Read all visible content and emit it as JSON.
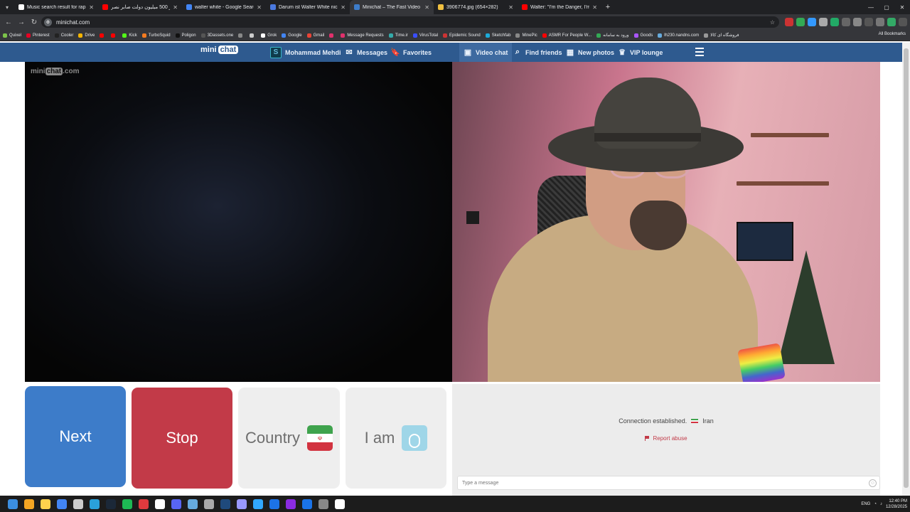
{
  "browser": {
    "tabs": [
      {
        "title": "Music search result for rap | Ep",
        "color": "#ffffff",
        "icon": "pixabay-icon"
      },
      {
        "title": "از 500 میلیون دولت صابر نصر... ",
        "color": "#ff0000",
        "icon": "youtube-icon"
      },
      {
        "title": "walter white - Google Search",
        "color": "#4285f4",
        "icon": "google-icon"
      },
      {
        "title": "Darum ist Walter White nicht b",
        "color": "#4a79e0",
        "icon": "site-icon"
      },
      {
        "title": "Minichat – The Fast Video C",
        "color": "#3d7cc9",
        "icon": "minichat-icon",
        "active": true
      },
      {
        "title": "3906774.jpg (654×282)",
        "color": "#f0c040",
        "icon": "image-icon"
      },
      {
        "title": "Walter: \"I'm the Danger, I'm the",
        "color": "#ff0000",
        "icon": "youtube-icon"
      }
    ],
    "url": "minichat.com",
    "bookmarks": [
      {
        "label": "Quixel",
        "color": "#7cc34a"
      },
      {
        "label": "Pinterest",
        "color": "#e60023"
      },
      {
        "label": "Cooler",
        "color": "#222"
      },
      {
        "label": "Drive",
        "color": "#f4b400"
      },
      {
        "label": "",
        "color": "#ff0000"
      },
      {
        "label": "",
        "color": "#ff0000"
      },
      {
        "label": "Kick",
        "color": "#53fc18"
      },
      {
        "label": "TurboSquid",
        "color": "#f47b20"
      },
      {
        "label": "Poligon",
        "color": "#111"
      },
      {
        "label": "3Dassets.one",
        "color": "#555"
      },
      {
        "label": "",
        "color": "#888"
      },
      {
        "label": "",
        "color": "#ccc"
      },
      {
        "label": "Grok",
        "color": "#fff"
      },
      {
        "label": "Google",
        "color": "#4285f4"
      },
      {
        "label": "Gmail",
        "color": "#ea4335"
      },
      {
        "label": "",
        "color": "#e1306c"
      },
      {
        "label": "Message Requests",
        "color": "#e1306c"
      },
      {
        "label": "Time.ir",
        "color": "#3aa"
      },
      {
        "label": "VirusTotal",
        "color": "#394eff"
      },
      {
        "label": "Epidemic Sound",
        "color": "#c33"
      },
      {
        "label": "Sketchfab",
        "color": "#1caad9"
      },
      {
        "label": "MinePic",
        "color": "#888"
      },
      {
        "label": "ASMR For People W...",
        "color": "#ff0000"
      },
      {
        "label": "ورود به سامانه",
        "color": "#3a5"
      },
      {
        "label": "Goods",
        "color": "#a5f"
      },
      {
        "label": "lh230.nandns.com",
        "color": "#6ad"
      },
      {
        "label": "فروشگاه ای کالا",
        "color": "#999"
      }
    ],
    "all_bookmarks": "All Bookmarks"
  },
  "site": {
    "logo_left": "mini",
    "logo_right": "chat",
    "username": "Mohammad Mehdi",
    "nav": {
      "messages": "Messages",
      "favorites": "Favorites",
      "video_chat": "Video chat",
      "find_friends": "Find friends",
      "new_photos": "New photos",
      "vip_lounge": "VIP lounge"
    },
    "watermark_left": "mini",
    "watermark_mid": "chat",
    "watermark_right": ".com"
  },
  "controls": {
    "next": "Next",
    "stop": "Stop",
    "country": "Country",
    "iam": "I am",
    "country_flag": "iran-flag-icon"
  },
  "chat": {
    "status": "Connection established.",
    "country": "Iran",
    "report": "Report abuse",
    "placeholder": "Type a message"
  },
  "taskbar": {
    "lang": "ENG",
    "time": "12:40 PM",
    "date": "12/28/2025",
    "icons": [
      "#3b8ee0",
      "#f5a623",
      "#ffd24d",
      "#4285f4",
      "#ccc",
      "#2aa1da",
      "#1b2838",
      "#1db954",
      "#e03a3e",
      "#fff",
      "#5865f2",
      "#6ad",
      "#aaa",
      "#1f4a7c",
      "#9999ff",
      "#31a8ff",
      "#1c73e8",
      "#8a2be2",
      "#1a73e8",
      "#888",
      "#fff"
    ],
    "accent": "#1c1c1c"
  },
  "colors": {
    "header_bg": "#2e5a8f",
    "next_bg": "#3d7cc9",
    "stop_bg": "#c23a48",
    "neutral_bg": "#eeeeee",
    "report_color": "#c23a48"
  }
}
